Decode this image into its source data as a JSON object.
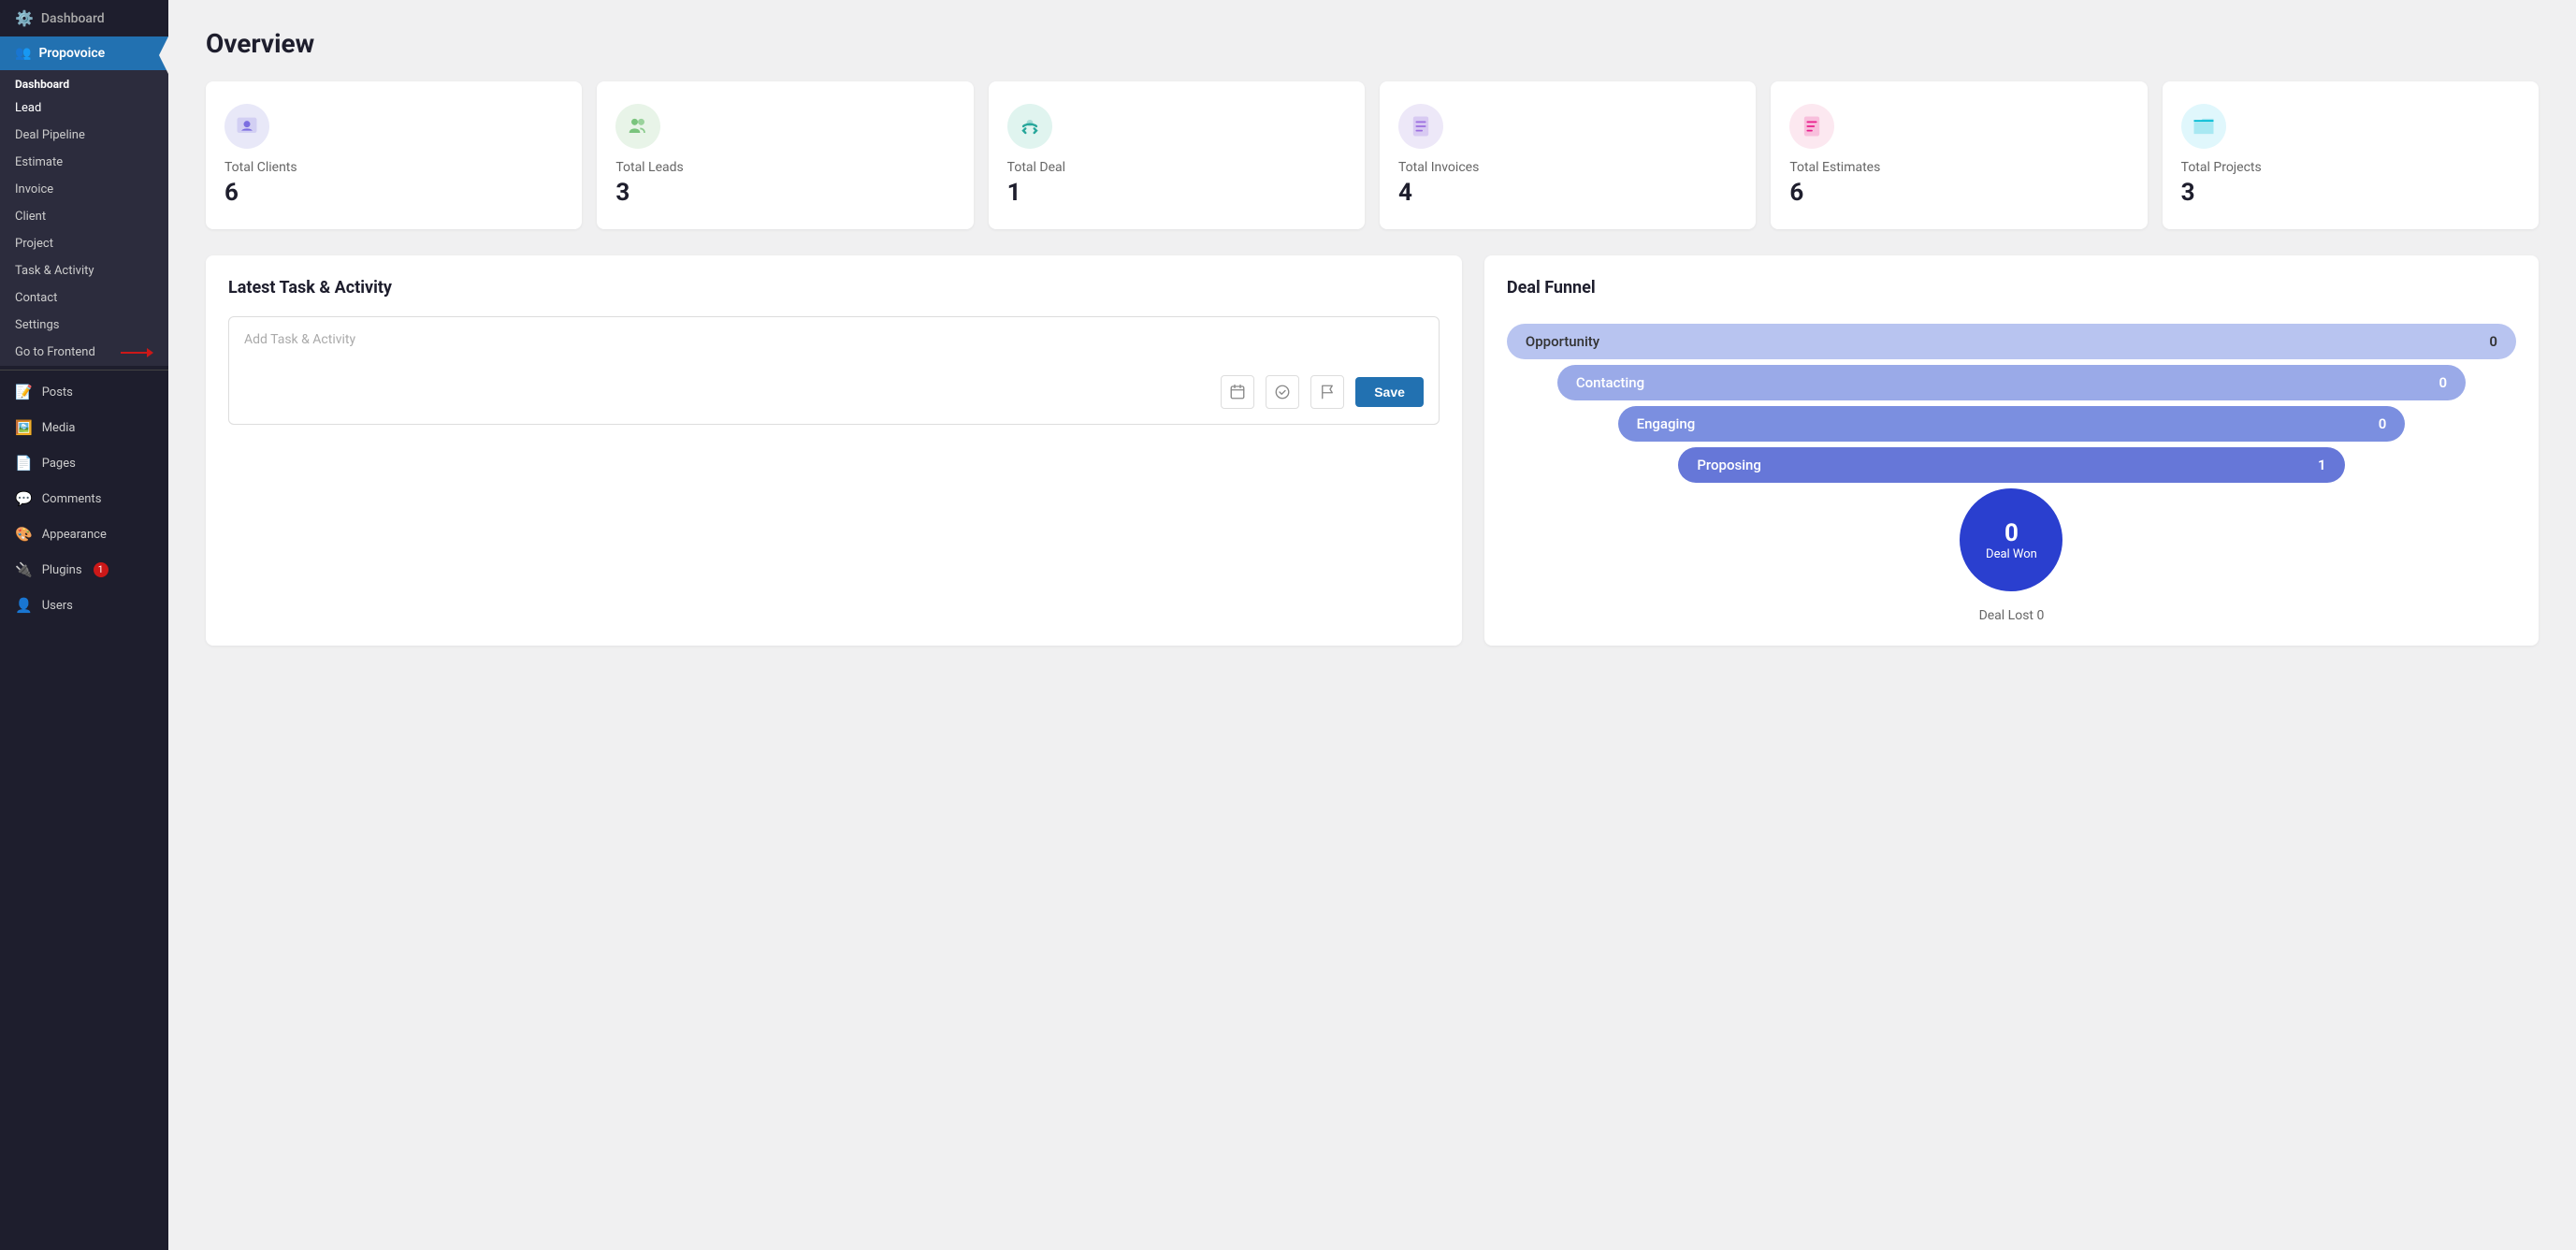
{
  "sidebar": {
    "dashboard_plugin": "Dashboard",
    "provoice_label": "Propovoice",
    "nav": {
      "section_label": "Dashboard",
      "items": [
        {
          "label": "Lead",
          "id": "lead"
        },
        {
          "label": "Deal Pipeline",
          "id": "deal-pipeline"
        },
        {
          "label": "Estimate",
          "id": "estimate"
        },
        {
          "label": "Invoice",
          "id": "invoice"
        },
        {
          "label": "Client",
          "id": "client"
        },
        {
          "label": "Project",
          "id": "project"
        },
        {
          "label": "Task & Activity",
          "id": "task-activity"
        },
        {
          "label": "Contact",
          "id": "contact"
        },
        {
          "label": "Settings",
          "id": "settings"
        },
        {
          "label": "Go to Frontend",
          "id": "go-frontend"
        }
      ]
    },
    "wp_items": [
      {
        "label": "Posts",
        "icon": "📝"
      },
      {
        "label": "Media",
        "icon": "🖼️"
      },
      {
        "label": "Pages",
        "icon": "📄"
      },
      {
        "label": "Comments",
        "icon": "💬"
      },
      {
        "label": "Appearance",
        "icon": "🎨"
      },
      {
        "label": "Plugins",
        "icon": "🔌",
        "badge": "1"
      },
      {
        "label": "Users",
        "icon": "👤"
      }
    ]
  },
  "header": {
    "title": "Overview"
  },
  "stats": [
    {
      "label": "Total Clients",
      "value": "6",
      "color": "#e8e8f8",
      "icon": "👤"
    },
    {
      "label": "Total Leads",
      "value": "3",
      "color": "#e8f4e8",
      "icon": "👥"
    },
    {
      "label": "Total Deal",
      "value": "1",
      "color": "#e8f4f0",
      "icon": "🤝"
    },
    {
      "label": "Total Invoices",
      "value": "4",
      "color": "#f0eafc",
      "icon": "📋"
    },
    {
      "label": "Total Estimates",
      "value": "6",
      "color": "#fce8f0",
      "icon": "📊"
    },
    {
      "label": "Total Projects",
      "value": "3",
      "color": "#e8f8fc",
      "icon": "📁"
    }
  ],
  "task_section": {
    "title": "Latest Task & Activity",
    "input_placeholder": "Add Task & Activity",
    "save_label": "Save"
  },
  "funnel": {
    "title": "Deal Funnel",
    "stages": [
      {
        "label": "Opportunity",
        "count": "0"
      },
      {
        "label": "Contacting",
        "count": "0"
      },
      {
        "label": "Engaging",
        "count": "0"
      },
      {
        "label": "Proposing",
        "count": "1"
      },
      {
        "label": "Deal Won",
        "count": "0"
      }
    ],
    "deal_lost_label": "Deal Lost 0"
  }
}
